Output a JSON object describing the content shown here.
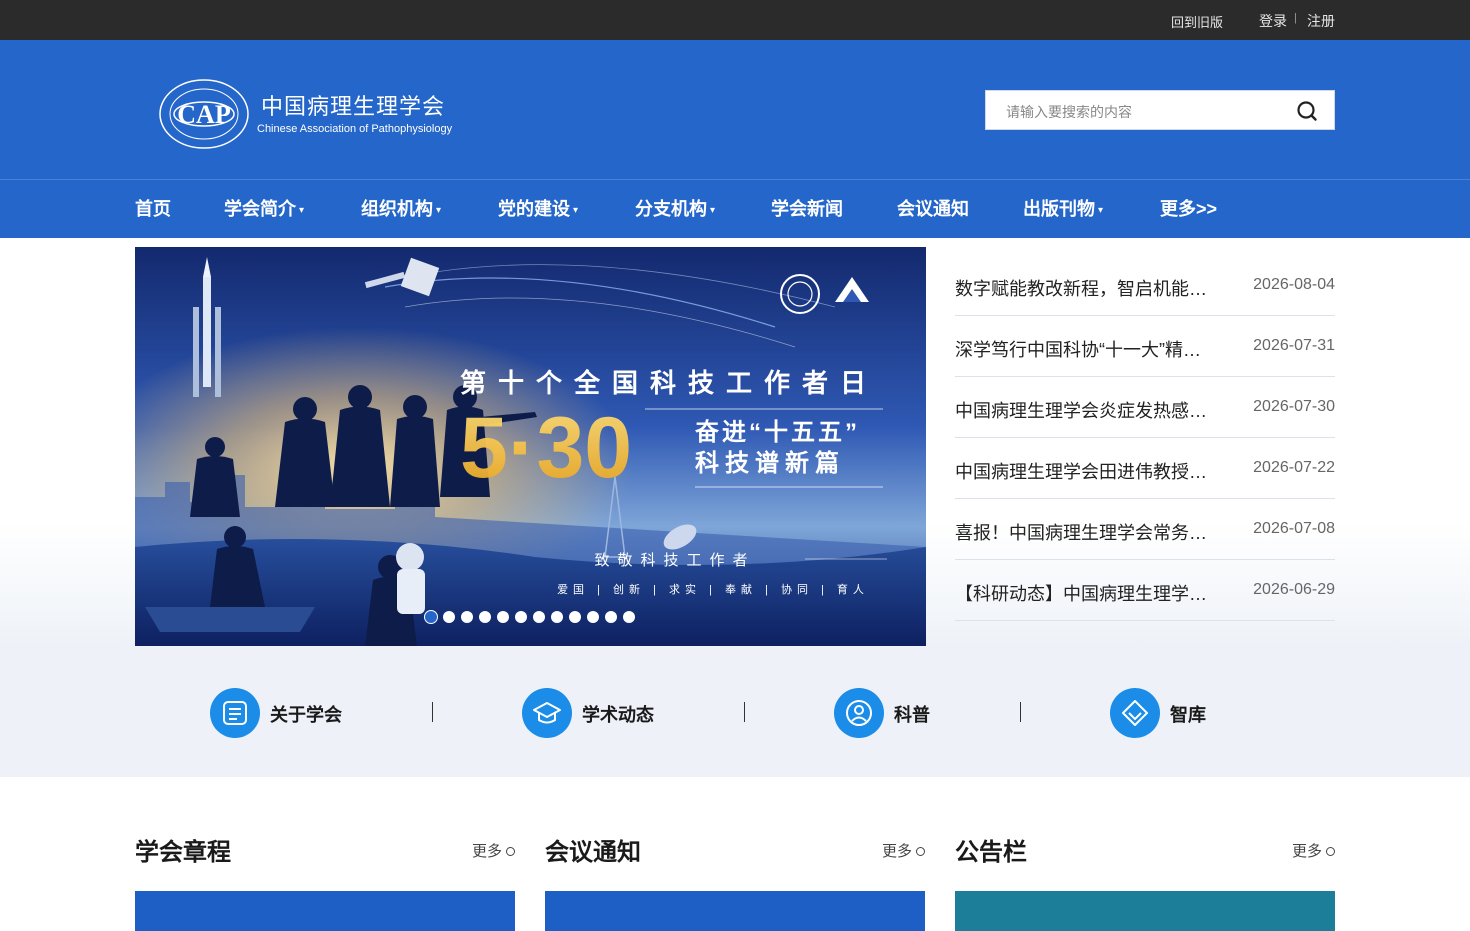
{
  "topbar": {
    "old_version": "回到旧版",
    "login": "登录",
    "separator": "|",
    "register": "注册"
  },
  "header": {
    "logo_cn": "中国病理生理学会",
    "logo_en": "Chinese Association of Pathophysiology",
    "logo_mark": "CAP",
    "search_placeholder": "请输入要搜索的内容"
  },
  "nav": [
    {
      "label": "首页",
      "dropdown": false
    },
    {
      "label": "学会简介",
      "dropdown": true
    },
    {
      "label": "组织机构",
      "dropdown": true
    },
    {
      "label": "党的建设",
      "dropdown": true
    },
    {
      "label": "分支机构",
      "dropdown": true
    },
    {
      "label": "学会新闻",
      "dropdown": false
    },
    {
      "label": "会议通知",
      "dropdown": false
    },
    {
      "label": "出版刊物",
      "dropdown": true
    },
    {
      "label": "更多>>",
      "dropdown": false
    }
  ],
  "banner": {
    "headline": "第十个全国科技工作者日",
    "big_number": "5·30",
    "slogan_1": "奋进“十五五”",
    "slogan_2": "科技谱新篇",
    "salute": "致敬科技工作者",
    "values": "爱国 | 创新 | 求实 | 奉献 | 协同 | 育人",
    "slide_count": 12,
    "active_slide": 1
  },
  "news": [
    {
      "title": "数字赋能教改新程，智启机能…",
      "date": "2026-08-04"
    },
    {
      "title": "深学笃行中国科协“十一大”精…",
      "date": "2026-07-31"
    },
    {
      "title": "中国病理生理学会炎症发热感…",
      "date": "2026-07-30"
    },
    {
      "title": "中国病理生理学会田进伟教授…",
      "date": "2026-07-22"
    },
    {
      "title": "喜报！中国病理生理学会常务…",
      "date": "2026-07-08"
    },
    {
      "title": "【科研动态】中国病理生理学…",
      "date": "2026-06-29"
    }
  ],
  "quick_links": [
    {
      "label": "关于学会",
      "icon": "document-icon"
    },
    {
      "label": "学术动态",
      "icon": "graduation-cap-icon"
    },
    {
      "label": "科普",
      "icon": "user-icon"
    },
    {
      "label": "智库",
      "icon": "diamond-icon"
    }
  ],
  "sections": [
    {
      "title": "学会章程",
      "more": "更多"
    },
    {
      "title": "会议通知",
      "more": "更多"
    },
    {
      "title": "公告栏",
      "more": "更多"
    }
  ],
  "colors": {
    "primary": "#2466c9",
    "topbar": "#2b2b2b",
    "icon_blue": "#1b8ce8",
    "quick_bg": "#eef2f8"
  }
}
